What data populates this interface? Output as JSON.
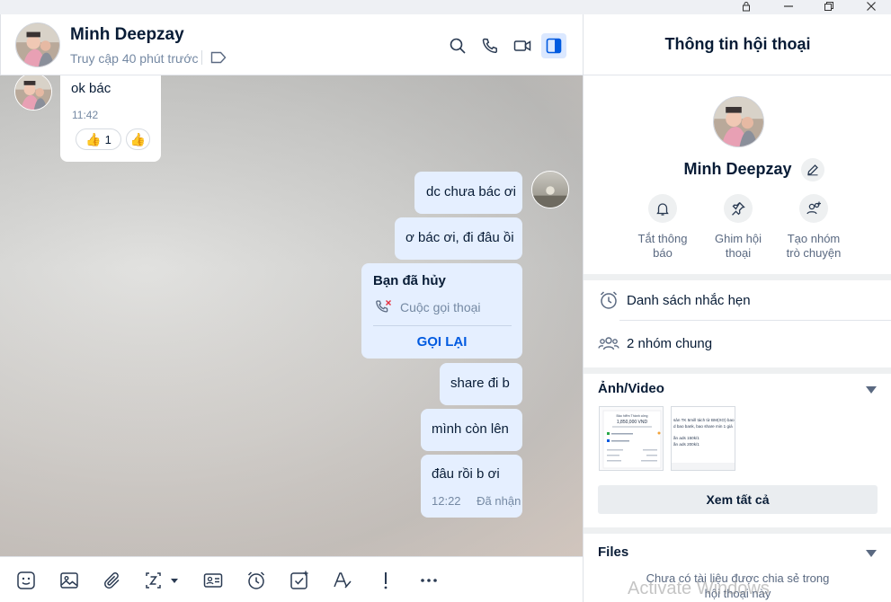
{
  "window_controls": {
    "lock": "lock-icon",
    "minimize": "minimize-icon",
    "maximize": "restore-icon",
    "close": "close-icon"
  },
  "contact": {
    "name": "Minh Deepzay",
    "status": "Truy cập 40 phút trước"
  },
  "header_actions": [
    "search-icon",
    "phone-icon",
    "video-icon",
    "panel-toggle-icon"
  ],
  "messages": {
    "incoming": {
      "text": "ok bác",
      "time": "11:42",
      "reaction_count": "1",
      "reaction_emoji": "👍"
    },
    "outgoing": [
      {
        "text": "dc chưa bác ơi"
      },
      {
        "text": "ơ bác ơi, đi đâu ồi"
      },
      {
        "type": "call",
        "title": "Bạn đã hủy",
        "subtitle": "Cuộc gọi thoại",
        "action": "GỌI LẠI"
      },
      {
        "text": "share đi b"
      },
      {
        "text": "mình còn lên"
      },
      {
        "text": "đâu rồi b ơi",
        "time": "12:22",
        "status": "Đã nhận"
      }
    ]
  },
  "toolbar": [
    "sticker-icon",
    "image-icon",
    "attachment-icon",
    "screenshot-icon",
    "contact-card-icon",
    "reminder-icon",
    "task-icon",
    "format-text-icon",
    "important-icon",
    "more-icon"
  ],
  "info_panel": {
    "title": "Thông tin hội thoại",
    "name": "Minh Deepzay",
    "actions": [
      {
        "label1": "Tắt thông",
        "label2": "báo"
      },
      {
        "label1": "Ghim hội",
        "label2": "thoại"
      },
      {
        "label1": "Tạo nhóm",
        "label2": "trò chuyện"
      }
    ],
    "reminders": "Danh sách nhắc hẹn",
    "common_groups": "2 nhóm chung",
    "media_title": "Ảnh/Video",
    "thumb1": {
      "line1": "Bảo hiểm Thành công",
      "line2": "1,850,000 VND"
    },
    "thumb2": {
      "line1": "sản TK 5mill tách từ BM(XO) bao",
      "line2": "d bao bank, bao share min 1 giá",
      "line3": "ần ads 150k/1",
      "line4": "ần ads 200k/1"
    },
    "view_all": "Xem tất cả",
    "files_title": "Files",
    "files_empty_line1": "Chưa có tài liệu được chia sẻ trong",
    "files_empty_line2": "hội thoại này"
  },
  "watermark": "Activate Windows",
  "colors": {
    "accent": "#005ae0",
    "outgoing_bubble": "#e5efff",
    "active_icon_bg": "#dbe8ff"
  }
}
